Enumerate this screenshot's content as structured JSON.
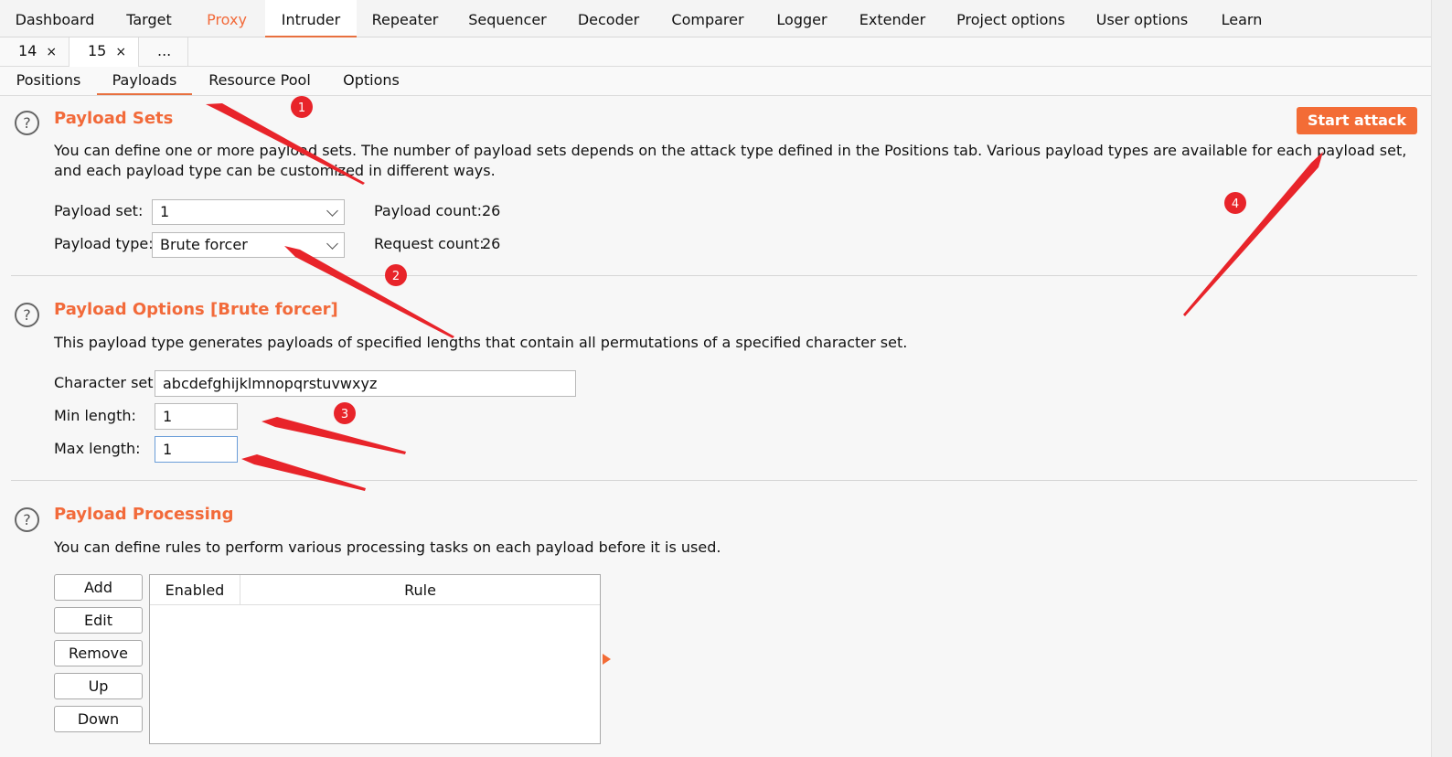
{
  "top_tabs": [
    {
      "label": "Dashboard"
    },
    {
      "label": "Target"
    },
    {
      "label": "Proxy"
    },
    {
      "label": "Intruder"
    },
    {
      "label": "Repeater"
    },
    {
      "label": "Sequencer"
    },
    {
      "label": "Decoder"
    },
    {
      "label": "Comparer"
    },
    {
      "label": "Logger"
    },
    {
      "label": "Extender"
    },
    {
      "label": "Project options"
    },
    {
      "label": "User options"
    },
    {
      "label": "Learn"
    }
  ],
  "attack_tabs": [
    {
      "label": "14",
      "close": "×"
    },
    {
      "label": "15",
      "close": "×"
    },
    {
      "label": "..."
    }
  ],
  "inner_tabs": [
    {
      "label": "Positions"
    },
    {
      "label": "Payloads"
    },
    {
      "label": "Resource Pool"
    },
    {
      "label": "Options"
    }
  ],
  "help_glyph": "?",
  "payload_sets": {
    "title": "Payload Sets",
    "description": "You can define one or more payload sets. The number of payload sets depends on the attack type defined in the Positions tab. Various payload types are available for each payload set, and each payload type can be customized in different ways.",
    "set_label": "Payload set:",
    "set_value": "1",
    "type_label": "Payload type:",
    "type_value": "Brute forcer",
    "payload_count_label": "Payload count:",
    "payload_count": "26",
    "request_count_label": "Request count:",
    "request_count": "26"
  },
  "start_attack_label": "Start attack",
  "payload_options": {
    "title": "Payload Options [Brute forcer]",
    "description": "This payload type generates payloads of specified lengths that contain all permutations of a specified character set.",
    "charset_label": "Character set:",
    "charset_value": "abcdefghijklmnopqrstuvwxyz",
    "min_label": "Min length:",
    "min_value": "1",
    "max_label": "Max length:",
    "max_value": "1"
  },
  "payload_processing": {
    "title": "Payload Processing",
    "description": "You can define rules to perform various processing tasks on each payload before it is used.",
    "buttons": {
      "add": "Add",
      "edit": "Edit",
      "remove": "Remove",
      "up": "Up",
      "down": "Down"
    },
    "columns": {
      "enabled": "Enabled",
      "rule": "Rule"
    }
  },
  "annotation_numbers": [
    "1",
    "2",
    "3",
    "4"
  ],
  "colors": {
    "accent": "#f26a3a",
    "annotation": "#e8242a"
  }
}
